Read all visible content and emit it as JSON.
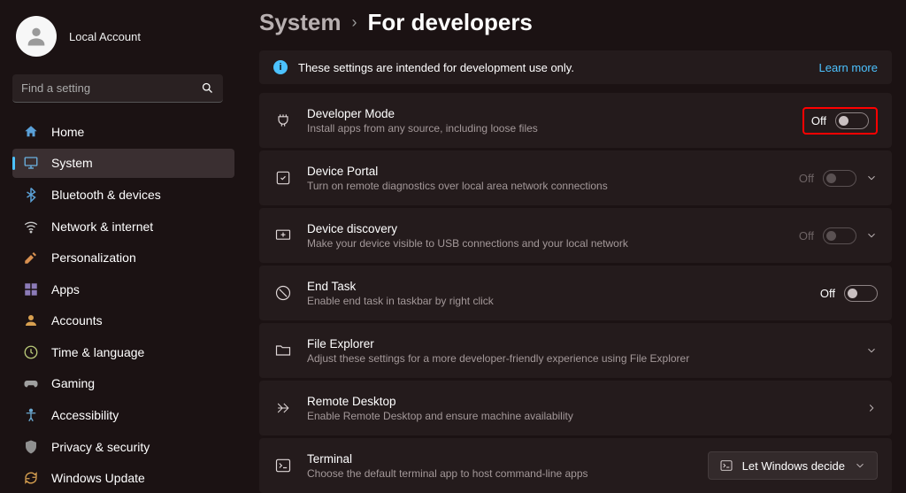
{
  "account": {
    "name": "Local Account"
  },
  "search": {
    "placeholder": "Find a setting"
  },
  "nav": [
    {
      "key": "home",
      "label": "Home",
      "icon": "home",
      "selected": false
    },
    {
      "key": "system",
      "label": "System",
      "icon": "system",
      "selected": true
    },
    {
      "key": "bluetooth",
      "label": "Bluetooth & devices",
      "icon": "bluetooth",
      "selected": false
    },
    {
      "key": "network",
      "label": "Network & internet",
      "icon": "network",
      "selected": false
    },
    {
      "key": "personalization",
      "label": "Personalization",
      "icon": "personalization",
      "selected": false
    },
    {
      "key": "apps",
      "label": "Apps",
      "icon": "apps",
      "selected": false
    },
    {
      "key": "accounts",
      "label": "Accounts",
      "icon": "accounts",
      "selected": false
    },
    {
      "key": "time",
      "label": "Time & language",
      "icon": "time",
      "selected": false
    },
    {
      "key": "gaming",
      "label": "Gaming",
      "icon": "gaming",
      "selected": false
    },
    {
      "key": "accessibility",
      "label": "Accessibility",
      "icon": "accessibility",
      "selected": false
    },
    {
      "key": "privacy",
      "label": "Privacy & security",
      "icon": "privacy",
      "selected": false
    },
    {
      "key": "update",
      "label": "Windows Update",
      "icon": "update",
      "selected": false
    }
  ],
  "breadcrumb": {
    "parent": "System",
    "current": "For developers"
  },
  "banner": {
    "text": "These settings are intended for development use only.",
    "link": "Learn more"
  },
  "cards": [
    {
      "key": "devmode",
      "title": "Developer Mode",
      "desc": "Install apps from any source, including loose files",
      "state": "Off",
      "type": "toggle",
      "highlight": true,
      "disabled": false
    },
    {
      "key": "portal",
      "title": "Device Portal",
      "desc": "Turn on remote diagnostics over local area network connections",
      "state": "Off",
      "type": "toggle-expand",
      "disabled": true
    },
    {
      "key": "discovery",
      "title": "Device discovery",
      "desc": "Make your device visible to USB connections and your local network",
      "state": "Off",
      "type": "toggle-expand",
      "disabled": true
    },
    {
      "key": "endtask",
      "title": "End Task",
      "desc": "Enable end task in taskbar by right click",
      "state": "Off",
      "type": "toggle",
      "disabled": false
    },
    {
      "key": "explorer",
      "title": "File Explorer",
      "desc": "Adjust these settings for a more developer-friendly experience using File Explorer",
      "type": "expand"
    },
    {
      "key": "remote",
      "title": "Remote Desktop",
      "desc": "Enable Remote Desktop and ensure machine availability",
      "type": "navigate"
    },
    {
      "key": "terminal",
      "title": "Terminal",
      "desc": "Choose the default terminal app to host command-line apps",
      "type": "dropdown",
      "dd": "Let Windows decide"
    }
  ]
}
